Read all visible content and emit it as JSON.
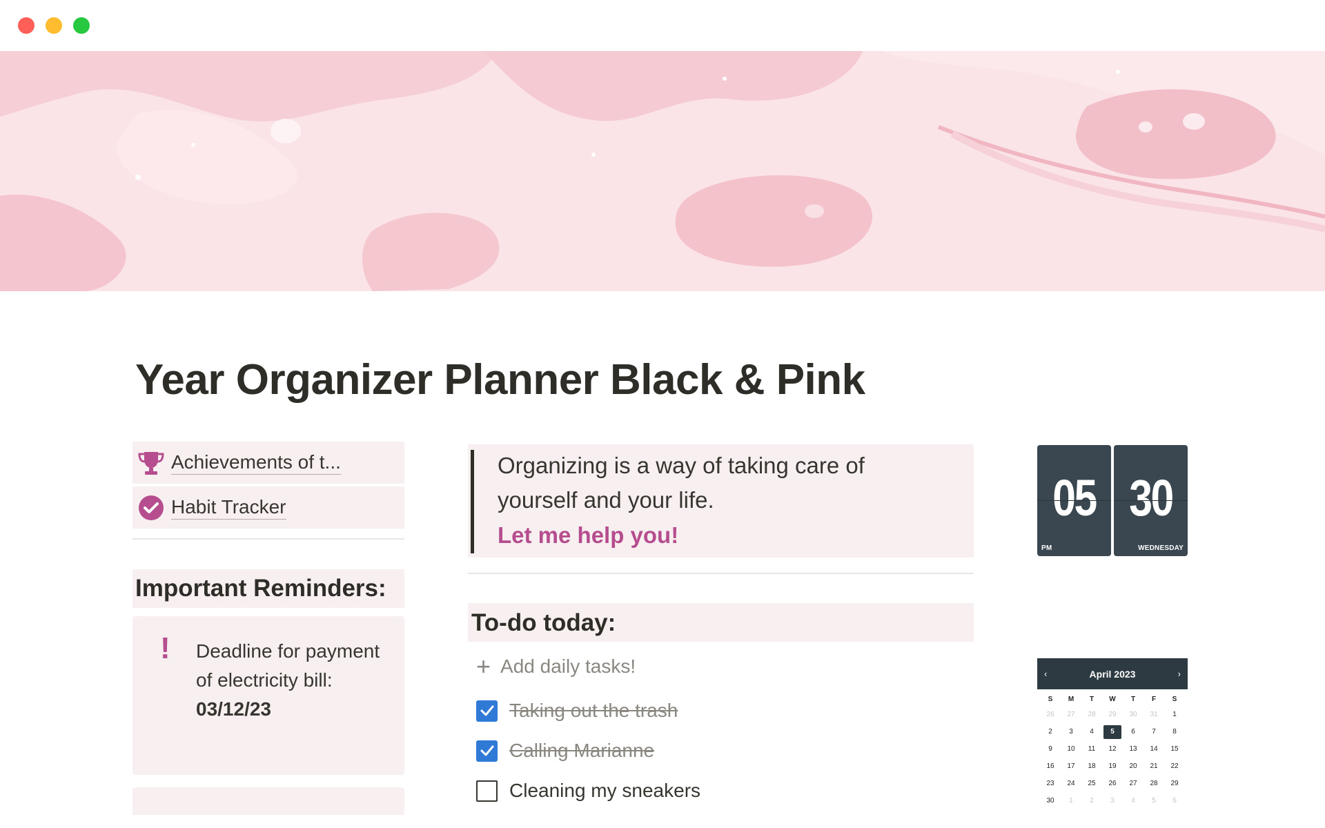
{
  "window": {
    "controls": [
      "close",
      "minimize",
      "zoom"
    ]
  },
  "cover": {
    "theme": "pink watercolor",
    "colors": {
      "base": "#fbe4e8",
      "blob": "#f6cfd6",
      "light": "#fdf1f3"
    }
  },
  "page": {
    "title": "Year Organizer Planner Black & Pink"
  },
  "links": [
    {
      "icon": "trophy-icon",
      "label": "Achievements of t..."
    },
    {
      "icon": "check-circle-icon",
      "label": "Habit Tracker"
    }
  ],
  "reminders": {
    "heading": "Important Reminders:",
    "items": [
      {
        "icon": "exclamation-icon",
        "text": "Deadline for payment of electricity bill:",
        "date": "03/12/23"
      }
    ]
  },
  "quote": {
    "line1": "Organizing is a way of taking care of",
    "line2": "yourself and your life.",
    "accent": "Let me help you!"
  },
  "todo": {
    "heading": "To-do today:",
    "add_label": "Add daily tasks!",
    "items": [
      {
        "text": "Taking out the trash",
        "checked": true
      },
      {
        "text": "Calling Marianne",
        "checked": true
      },
      {
        "text": "Cleaning my sneakers",
        "checked": false
      }
    ]
  },
  "clock": {
    "hour": "05",
    "minute": "30",
    "ampm": "PM",
    "weekday": "WEDNESDAY"
  },
  "calendar": {
    "month": "April 2023",
    "prev": "‹",
    "next": "›",
    "weekdays": [
      "S",
      "M",
      "T",
      "W",
      "T",
      "F",
      "S"
    ],
    "weeks": [
      [
        "26",
        "27",
        "28",
        "29",
        "30",
        "31",
        "1"
      ],
      [
        "2",
        "3",
        "4",
        "5",
        "6",
        "7",
        "8"
      ],
      [
        "9",
        "10",
        "11",
        "12",
        "13",
        "14",
        "15"
      ],
      [
        "16",
        "17",
        "18",
        "19",
        "20",
        "21",
        "22"
      ],
      [
        "23",
        "24",
        "25",
        "26",
        "27",
        "28",
        "29"
      ],
      [
        "30",
        "1",
        "2",
        "3",
        "4",
        "5",
        "6"
      ]
    ],
    "today": "5",
    "colors": {
      "header": "#2e3a42",
      "accent": "#b54d8e"
    }
  }
}
